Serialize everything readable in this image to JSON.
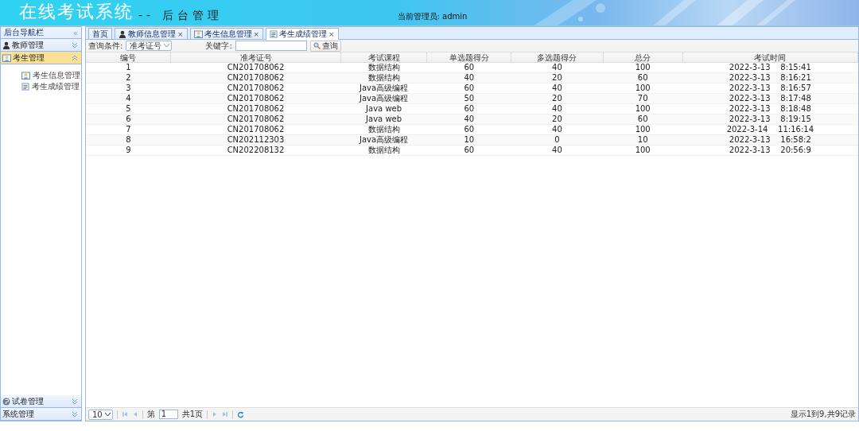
{
  "header": {
    "title": "在线考试系统",
    "subtitle": "-- 后台管理",
    "admin_label": "当前管理员:",
    "admin_name": "admin"
  },
  "sidebar": {
    "title": "后台导航栏",
    "collapse": "«",
    "groups": [
      {
        "label": "教师管理",
        "expanded": false
      },
      {
        "label": "考生管理",
        "expanded": true,
        "children": [
          {
            "label": "考生信息管理"
          },
          {
            "label": "考生成绩管理"
          }
        ]
      }
    ],
    "bottom_groups": [
      {
        "label": "试卷管理",
        "expanded": false
      },
      {
        "label": "系统管理",
        "expanded": false
      }
    ]
  },
  "tabs": [
    {
      "label": "首页",
      "selected": false
    },
    {
      "label": "教师信息管理",
      "close": "×",
      "selected": false
    },
    {
      "label": "考生信息管理",
      "close": "×",
      "selected": false
    },
    {
      "label": "考生成绩管理",
      "close": "×",
      "selected": true
    }
  ],
  "toolbar": {
    "condition_label": "查询条件:",
    "condition_value": "准考证号",
    "keyword_label": "关键字:",
    "search_button": "查询"
  },
  "table": {
    "columns": [
      "编号",
      "准考证号",
      "考试课程",
      "单选题得分",
      "多选题得分",
      "总分",
      "考试时间"
    ],
    "rows": [
      [
        "1",
        "CN201708062",
        "数据结构",
        "60",
        "40",
        "100",
        "2022-3-13    8:15:41"
      ],
      [
        "2",
        "CN201708062",
        "数据结构",
        "40",
        "20",
        "60",
        "2022-3-13    8:16:21"
      ],
      [
        "3",
        "CN201708062",
        "Java高级编程",
        "60",
        "40",
        "100",
        "2022-3-13    8:16:57"
      ],
      [
        "4",
        "CN201708062",
        "Java高级编程",
        "50",
        "20",
        "70",
        "2022-3-13    8:17:48"
      ],
      [
        "5",
        "CN201708062",
        "Java web",
        "60",
        "40",
        "100",
        "2022-3-13    8:18:48"
      ],
      [
        "6",
        "CN201708062",
        "Java web",
        "40",
        "20",
        "60",
        "2022-3-13    8:19:15"
      ],
      [
        "7",
        "CN201708062",
        "数据结构",
        "60",
        "40",
        "100",
        "2022-3-14    11:16:14"
      ],
      [
        "8",
        "CN202112303",
        "Java高级编程",
        "10",
        "0",
        "10",
        "2022-3-13    16:58:2"
      ],
      [
        "9",
        "CN202208132",
        "数据结构",
        "60",
        "40",
        "100",
        "2022-3-13    20:56:9"
      ]
    ]
  },
  "pager": {
    "page_size": "10",
    "page_prefix": "第",
    "page": "1",
    "page_total": "共1页",
    "summary": "显示1到9,共9记录"
  }
}
